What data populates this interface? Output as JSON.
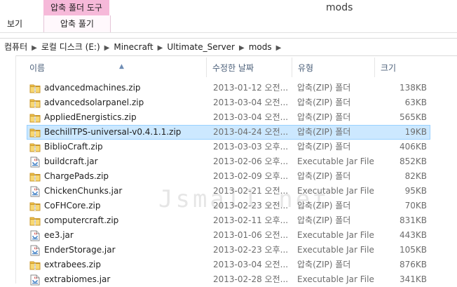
{
  "titlebar": {
    "context_tab": "압축 폴더 도구",
    "title": "mods"
  },
  "ribbon": {
    "view_tab": "보기",
    "extract_tab": "압축 풀기"
  },
  "address": {
    "crumbs": [
      "컴퓨터",
      "로컬 디스크 (E:)",
      "Minecraft",
      "Ultimate_Server",
      "mods"
    ]
  },
  "columns": {
    "name": "이름",
    "date": "수정한 날짜",
    "type": "유형",
    "size": "크기"
  },
  "files": [
    {
      "icon": "zip-folder-icon",
      "name": "advancedmachines.zip",
      "date": "2013-01-12 오전...",
      "type": "압축(ZIP) 폴더",
      "size": "138KB"
    },
    {
      "icon": "zip-folder-icon",
      "name": "advancedsolarpanel.zip",
      "date": "2013-03-04 오전...",
      "type": "압축(ZIP) 폴더",
      "size": "63KB"
    },
    {
      "icon": "zip-folder-icon",
      "name": "AppliedEnergistics.zip",
      "date": "2013-03-04 오전...",
      "type": "압축(ZIP) 폴더",
      "size": "565KB"
    },
    {
      "icon": "zip-folder-icon",
      "name": "BechillTPS-universal-v0.4.1.1.zip",
      "date": "2013-04-24 오전...",
      "type": "압축(ZIP) 폴더",
      "size": "19KB",
      "selected": true
    },
    {
      "icon": "zip-folder-icon",
      "name": "BiblioCraft.zip",
      "date": "2013-03-03 오후...",
      "type": "압축(ZIP) 폴더",
      "size": "406KB"
    },
    {
      "icon": "jar-file-icon",
      "name": "buildcraft.jar",
      "date": "2013-02-06 오후...",
      "type": "Executable Jar File",
      "size": "852KB"
    },
    {
      "icon": "zip-folder-icon",
      "name": "ChargePads.zip",
      "date": "2013-02-09 오후...",
      "type": "압축(ZIP) 폴더",
      "size": "82KB"
    },
    {
      "icon": "jar-file-icon",
      "name": "ChickenChunks.jar",
      "date": "2013-02-21 오전...",
      "type": "Executable Jar File",
      "size": "95KB"
    },
    {
      "icon": "zip-folder-icon",
      "name": "CoFHCore.zip",
      "date": "2013-02-23 오전...",
      "type": "압축(ZIP) 폴더",
      "size": "70KB"
    },
    {
      "icon": "zip-folder-icon",
      "name": "computercraft.zip",
      "date": "2013-02-11 오후...",
      "type": "압축(ZIP) 폴더",
      "size": "831KB"
    },
    {
      "icon": "jar-file-icon",
      "name": "ee3.jar",
      "date": "2013-01-06 오전...",
      "type": "Executable Jar File",
      "size": "443KB"
    },
    {
      "icon": "jar-file-icon",
      "name": "EnderStorage.jar",
      "date": "2013-02-23 오후...",
      "type": "Executable Jar File",
      "size": "105KB"
    },
    {
      "icon": "zip-folder-icon",
      "name": "extrabees.zip",
      "date": "2013-03-04 오전...",
      "type": "압축(ZIP) 폴더",
      "size": "876KB"
    },
    {
      "icon": "jar-file-icon",
      "name": "extrabiomes.jar",
      "date": "2013-02-28 오전...",
      "type": "Executable Jar File",
      "size": "341KB"
    }
  ],
  "watermark": "Jsmall.net",
  "colors": {
    "context_tab": "#f6b9d9",
    "selection": "#cce8ff",
    "selection_border": "#99d1ff"
  }
}
